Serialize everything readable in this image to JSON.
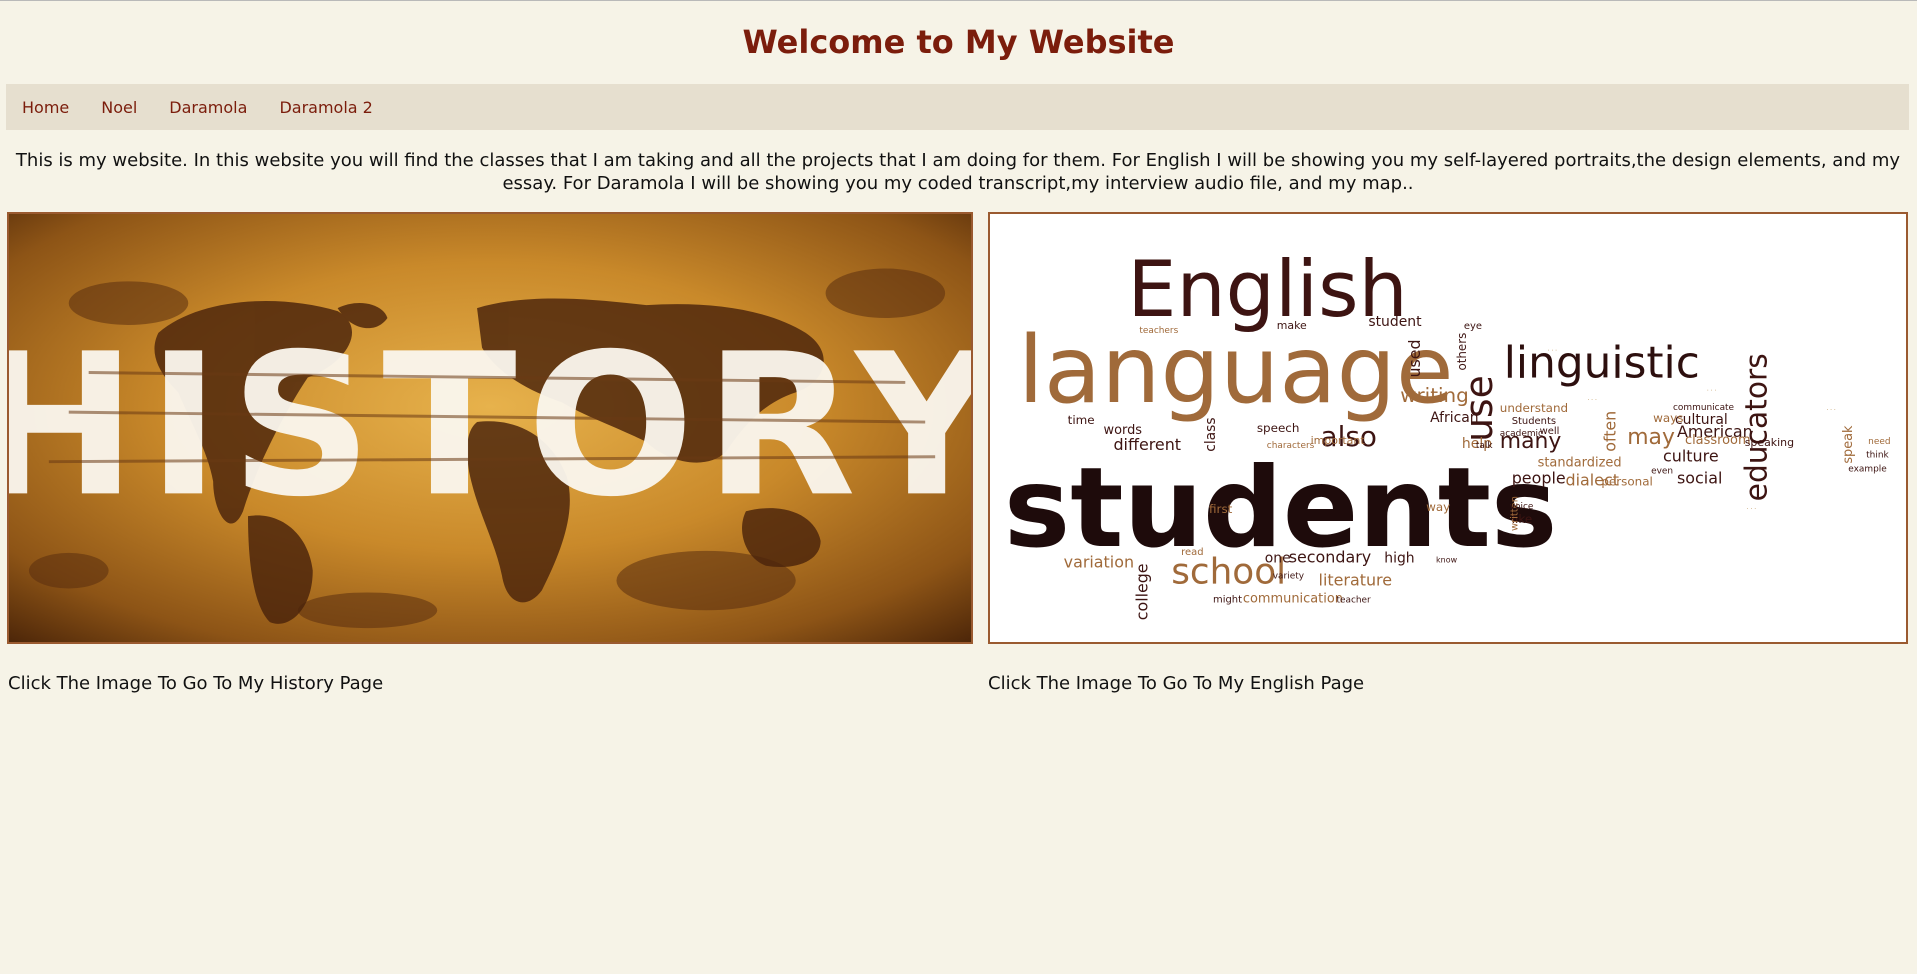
{
  "page": {
    "heading": "Welcome to My Website"
  },
  "nav": {
    "items": [
      {
        "label": "Home"
      },
      {
        "label": "Noel"
      },
      {
        "label": "Daramola"
      },
      {
        "label": "Daramola 2"
      }
    ]
  },
  "intro": {
    "text": "This is my website. In this website you will find the classes that I am taking and all the projects that I am doing for them. For English I will be showing you my self-layered portraits,the design elements, and my essay. For Daramola I will be showing you my coded transcript,my interview audio file, and my map.."
  },
  "history_card": {
    "image_text": "HISTORY",
    "caption": "Click The Image To Go To My History Page"
  },
  "english_card": {
    "words": {
      "w1": "English",
      "w2": "language",
      "w3": "students",
      "w4": "linguistic",
      "w5": "educators",
      "w6": "school",
      "w7": "also",
      "w8": "use",
      "w9": "writing",
      "w10": "many",
      "w11": "may",
      "w12": "American",
      "w13": "culture",
      "w14": "social",
      "w15": "people",
      "w16": "dialect",
      "w17": "variation",
      "w18": "literature",
      "w19": "secondary",
      "w20": "college",
      "w21": "different",
      "w22": "student",
      "w23": "used",
      "w24": "often",
      "w25": "cultural",
      "w26": "standardized",
      "w27": "communication",
      "w28": "classroom",
      "w29": "speak",
      "w30": "words",
      "w31": "African",
      "w32": "help",
      "w33": "high",
      "w34": "class",
      "w35": "speech",
      "w36": "one",
      "w37": "time",
      "w38": "first",
      "w39": "way",
      "w40": "like",
      "w41": "personal",
      "w42": "understand",
      "w43": "important",
      "w44": "speaking",
      "w45": "Students",
      "w46": "ways",
      "w47": "others",
      "w48": "make",
      "w49": "eye",
      "w50": "written",
      "w51": "read",
      "w52": "variety",
      "w53": "characters",
      "w54": "might",
      "w55": "teacher",
      "w56": "communicate",
      "w57": "even",
      "w58": "well",
      "w59": "academic",
      "w60": "know",
      "w61": "talk",
      "w62": "voice",
      "w63": "need",
      "w64": "think",
      "w65": "example",
      "w66": "teachers"
    },
    "caption": "Click The Image To Go To My English Page"
  },
  "colors": {
    "heading": "#7b1d0c",
    "nav_link": "#7b1d0c",
    "nav_bg": "#e6dfcf",
    "page_bg": "#f6f3e7",
    "word_dark": "#3d1412",
    "word_brown": "#a06a3a",
    "word_tan": "#b58a4a"
  }
}
